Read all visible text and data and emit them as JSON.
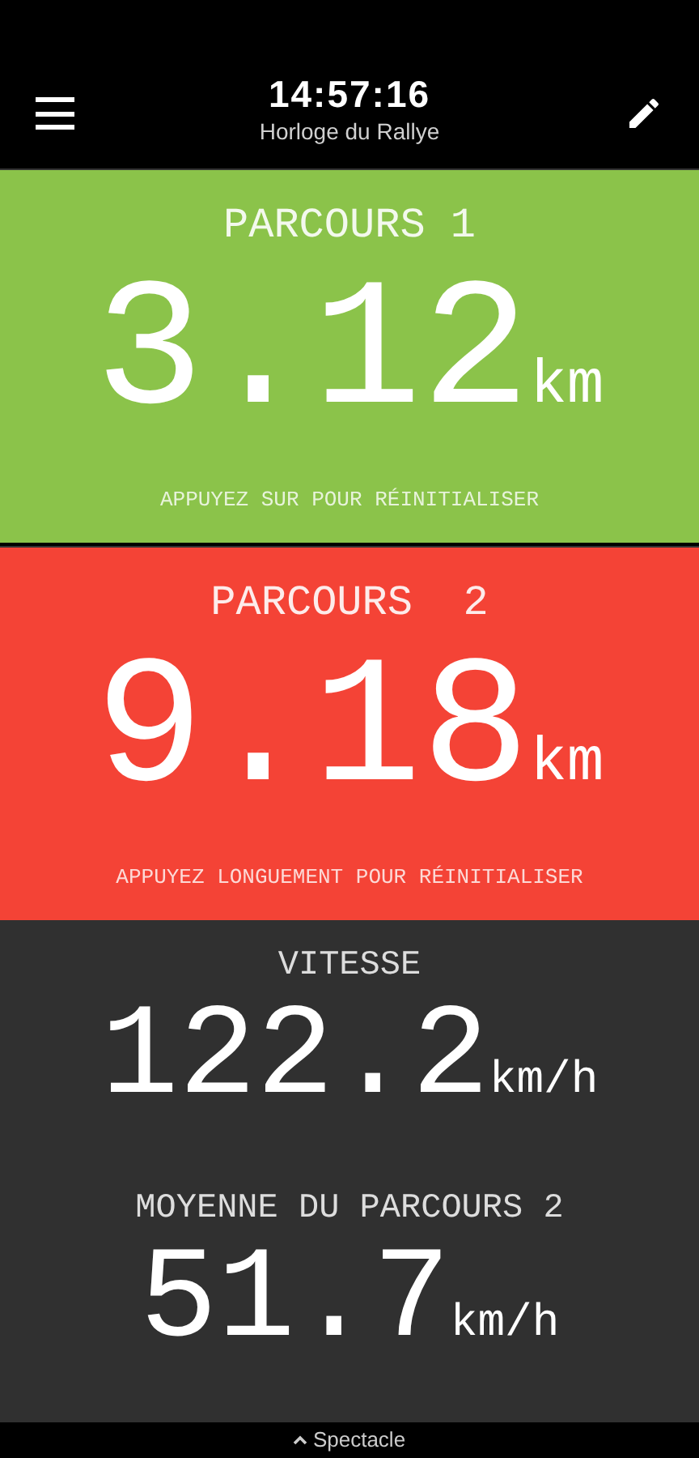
{
  "header": {
    "time": "14:57:16",
    "subtitle": "Horloge du Rallye"
  },
  "trips": [
    {
      "title": "PARCOURS 1",
      "value": "3.12",
      "unit": "km",
      "hint": "APPUYEZ SUR POUR RÉINITIALISER",
      "color": "#8bc34a"
    },
    {
      "title": "PARCOURS  2",
      "value": "9.18",
      "unit": "km",
      "hint": "APPUYEZ LONGUEMENT POUR RÉINITIALISER",
      "color": "#f44336"
    }
  ],
  "stats": [
    {
      "label": "VITESSE",
      "value": "122.2",
      "unit": "km/h"
    },
    {
      "label": "MOYENNE DU PARCOURS 2",
      "value": "51.7",
      "unit": "km/h"
    }
  ],
  "bottom_bar": {
    "label": "Spectacle"
  }
}
